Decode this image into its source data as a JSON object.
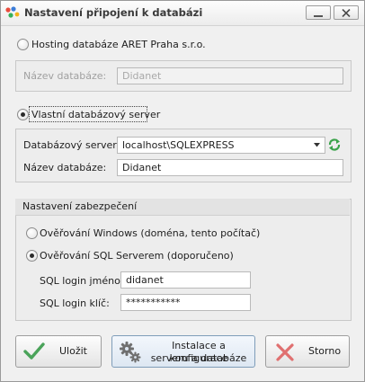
{
  "window": {
    "title": "Nastavení připojení k databázi"
  },
  "hosting": {
    "option_label": "Hosting databáze ARET Praha s.r.o.",
    "db_name_label": "Název databáze:",
    "db_name_value": "Didanet"
  },
  "own_server": {
    "option_label": "Vlastní databázový server",
    "server_label": "Databázový server:",
    "server_value": "localhost\\SQLEXPRESS",
    "db_name_label": "Název databáze:",
    "db_name_value": "Didanet"
  },
  "security": {
    "header": "Nastavení zabezpečení",
    "windows_auth_label": "Ověřování Windows (doména, tento počítač)",
    "sql_auth_label": "Ověřování SQL Serverem (doporučeno)",
    "login_name_label": "SQL login jméno:",
    "login_name_value": "didanet",
    "login_password_label": "SQL login klíč:",
    "login_password_value": "***********"
  },
  "buttons": {
    "save": "Uložit",
    "install_line1": "Instalace a konfigurace",
    "install_line2": "serveru a databáze",
    "cancel": "Storno"
  },
  "icons": {
    "app": "colored-dots-logo",
    "refresh": "refresh-icon",
    "save": "checkmark-icon",
    "install": "gears-icon",
    "cancel": "x-icon"
  },
  "colors": {
    "accent_green": "#3aa34a",
    "cancel_red": "#e07070",
    "checkmark_green": "#4aa35a"
  }
}
